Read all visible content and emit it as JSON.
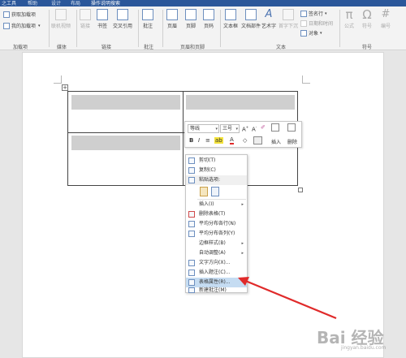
{
  "tabs": [
    "之工具",
    "帮助",
    "设计",
    "布局",
    "操作说明搜索"
  ],
  "ribbon": {
    "addins": {
      "get": "获取加载项",
      "mine": "我的加载项",
      "group": "加载项"
    },
    "media": {
      "video": "联机视频",
      "group": "媒体"
    },
    "links": {
      "link": "链接",
      "bookmark": "书签",
      "crossref": "交叉引用",
      "group": "链接"
    },
    "comments": {
      "comment": "批注",
      "group": "批注"
    },
    "header_footer": {
      "header": "页眉",
      "footer": "页脚",
      "page_number": "页码",
      "group": "页眉和页脚"
    },
    "text": {
      "textbox": "文本框",
      "quickparts": "文档部件",
      "wordart": "艺术字",
      "dropcap": "首字下沉",
      "signature": "签名行",
      "datetime": "日期和时间",
      "object": "对象",
      "group": "文本"
    },
    "symbols": {
      "formula": "公式",
      "symbol": "符号",
      "number": "编号",
      "group": "符号"
    }
  },
  "mini_toolbar": {
    "font": "等线",
    "size": "三号",
    "insert": "插入",
    "delete": "删除"
  },
  "context_menu": [
    {
      "label": "剪切(T)",
      "icon": "cut-icon"
    },
    {
      "label": "复制(C)",
      "icon": "copy-icon"
    },
    {
      "label": "粘贴选项:",
      "icon": "paste-icon"
    },
    {
      "label": "",
      "icon": "paste-options-icons"
    },
    {
      "label": "插入(I)",
      "submenu": true
    },
    {
      "label": "删除表格(T)",
      "icon": "delete-table-icon"
    },
    {
      "label": "平均分布各行(N)",
      "icon": "distribute-rows-icon"
    },
    {
      "label": "平均分布各列(Y)",
      "icon": "distribute-columns-icon"
    },
    {
      "label": "边框样式(B)",
      "submenu": true
    },
    {
      "label": "自动调整(A)",
      "submenu": true
    },
    {
      "label": "文字方向(X)...",
      "icon": "text-direction-icon"
    },
    {
      "label": "插入题注(C)...",
      "icon": "caption-icon"
    },
    {
      "label": "表格属性(R)...",
      "icon": "table-properties-icon",
      "highlighted": true
    },
    {
      "label": "新建批注(M)",
      "icon": "new-comment-icon"
    }
  ],
  "watermark": {
    "brand": "Bai 经验",
    "sub": "jingyan.baidu.com"
  },
  "colors": {
    "accent": "#2b579a",
    "highlight": "#c5dcf2",
    "arrow": "#e02a2a"
  }
}
